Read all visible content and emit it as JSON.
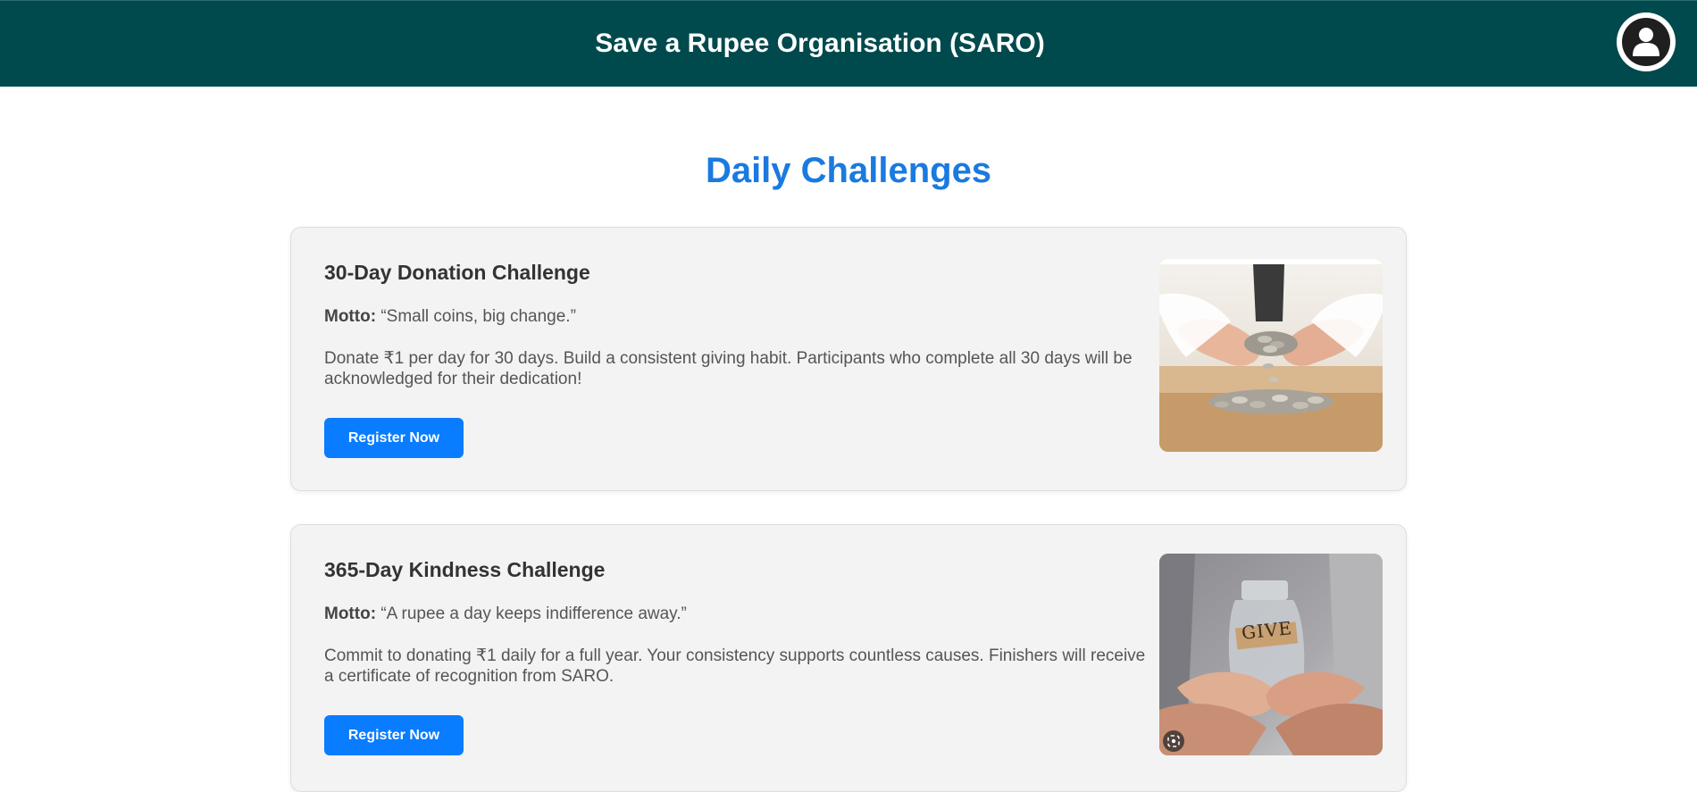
{
  "header": {
    "title": "Save a Rupee Organisation (SARO)",
    "profile_icon": "user-avatar-icon"
  },
  "page": {
    "title": "Daily Challenges"
  },
  "challenges": [
    {
      "title": "30-Day Donation Challenge",
      "motto_label": "Motto:",
      "motto": "“Small coins, big change.”",
      "description": "Donate ₹1 per day for 30 days. Build a consistent giving habit. Participants who complete all 30 days will be acknowledged for their dedication!",
      "button_label": "Register Now",
      "image": "hands-holding-coins"
    },
    {
      "title": "365-Day Kindness Challenge",
      "motto_label": "Motto:",
      "motto": "“A rupee a day keeps indifference away.”",
      "description": "Commit to donating ₹1 daily for a full year. Your consistency supports countless causes. Finishers will receive a certificate of recognition from SARO.",
      "button_label": "Register Now",
      "image": "hands-holding-give-jar",
      "image_jar_label": "GIVE"
    }
  ],
  "colors": {
    "header_bg": "#004a4d",
    "accent_blue": "#1a7ae0",
    "button_blue": "#0a7cff",
    "card_bg": "#f3f3f3"
  }
}
